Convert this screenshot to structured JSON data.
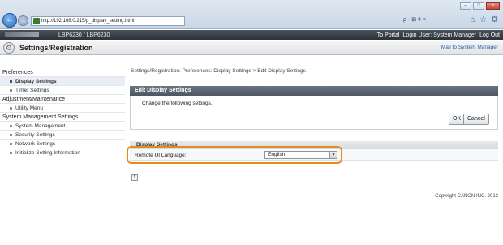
{
  "browser": {
    "url": "http://192.168.0.215/p_display_setting.html",
    "window_controls": [
      "–",
      "□",
      "×"
    ],
    "address_tools": "ρ - ⊠ ¢ ×",
    "home_icons": [
      "⌂",
      "☆",
      "⚙"
    ]
  },
  "device": {
    "model": "LBP6230 / LBP6230",
    "links": [
      "To Portal",
      "Login User: System Manager",
      "Log Out"
    ]
  },
  "header": {
    "title": "Settings/Registration",
    "mail_link": "Mail to System Manager"
  },
  "sidebar": {
    "items": [
      {
        "label": "Preferences",
        "level": "category"
      },
      {
        "label": "Display Settings",
        "level": "sub",
        "active": true
      },
      {
        "label": "Timer Settings",
        "level": "sub"
      },
      {
        "label": "Adjustment/Maintenance",
        "level": "category"
      },
      {
        "label": "Utility Menu",
        "level": "sub"
      },
      {
        "label": "System Management Settings",
        "level": "category"
      },
      {
        "label": "System Management",
        "level": "sub"
      },
      {
        "label": "Security Settings",
        "level": "sub"
      },
      {
        "label": "Network Settings",
        "level": "sub"
      },
      {
        "label": "Initialize Setting Information",
        "level": "sub"
      }
    ]
  },
  "main": {
    "breadcrumb": "Settings/Registration: Preferences: Display Settings > Edit Display Settings",
    "panel_title": "Edit Display Settings",
    "instruction": "Change the following settings.",
    "ok_label": "OK",
    "cancel_label": "Cancel",
    "section_title": "Display Settings",
    "setting_label": "Remote UI Language:",
    "language_value": "English",
    "top_icon": "⇑"
  },
  "footer": {
    "copyright": "Copyright CANON INC. 2013"
  },
  "colors": {
    "highlight": "#e88a1a",
    "device_bar": "#2c3238",
    "panel_header": "#4c5763"
  }
}
